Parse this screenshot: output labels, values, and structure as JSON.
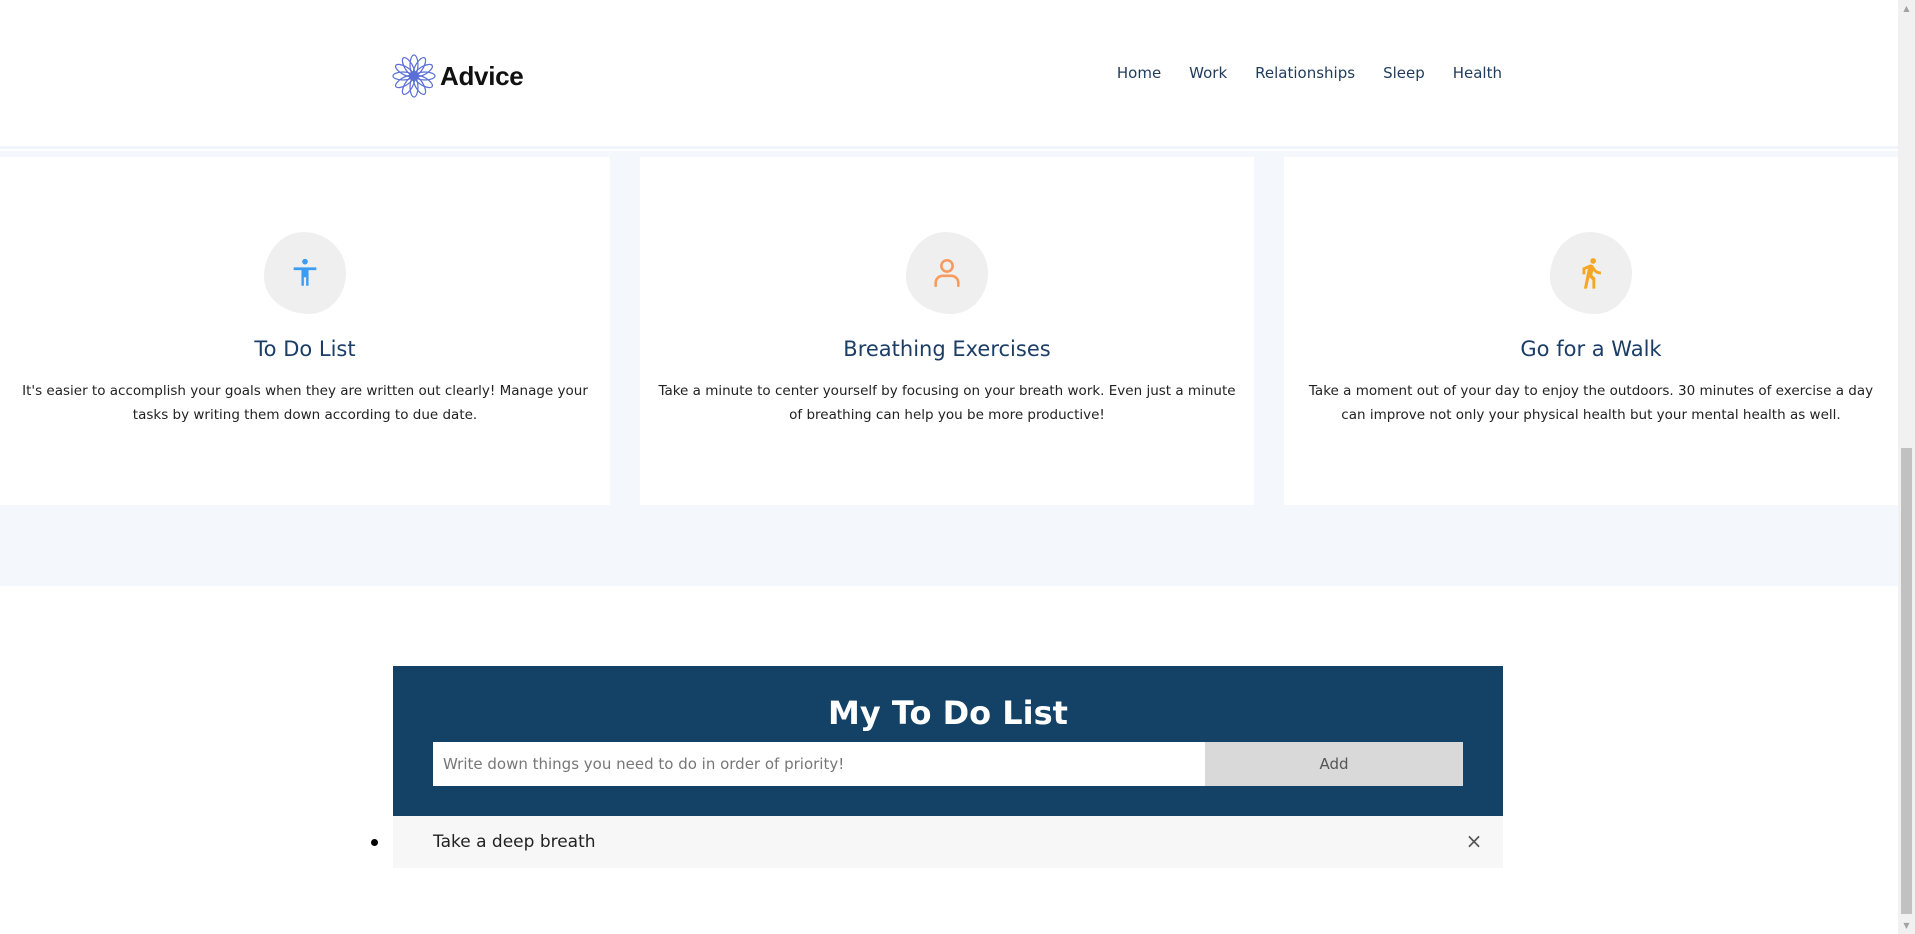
{
  "header": {
    "logo_text": "Advice",
    "nav": [
      "Home",
      "Work",
      "Relationships",
      "Sleep",
      "Health"
    ]
  },
  "features": [
    {
      "icon": "accessibility-icon",
      "icon_color": "#3b9cf3",
      "title": "To Do List",
      "description": "It's easier to accomplish your goals when they are written out clearly! Manage your tasks by writing them down according to due date."
    },
    {
      "icon": "person-icon",
      "icon_color": "#f79a5e",
      "title": "Breathing Exercises",
      "description": "Take a minute to center yourself by focusing on your breath work. Even just a minute of breathing can help you be more productive!"
    },
    {
      "icon": "walking-icon",
      "icon_color": "#f5a623",
      "title": "Go for a Walk",
      "description": "Take a moment out of your day to enjoy the outdoors. 30 minutes of exercise a day can improve not only your physical health but your mental health as well."
    }
  ],
  "todo": {
    "title": "My To Do List",
    "input_placeholder": "Write down things you need to do in order of priority!",
    "input_value": "",
    "add_label": "Add",
    "items": [
      "Take a deep breath"
    ],
    "close_glyph": "×"
  },
  "colors": {
    "panel_bg": "#134266",
    "title_color": "#1b3d66",
    "band_bg": "#f4f7fb"
  }
}
